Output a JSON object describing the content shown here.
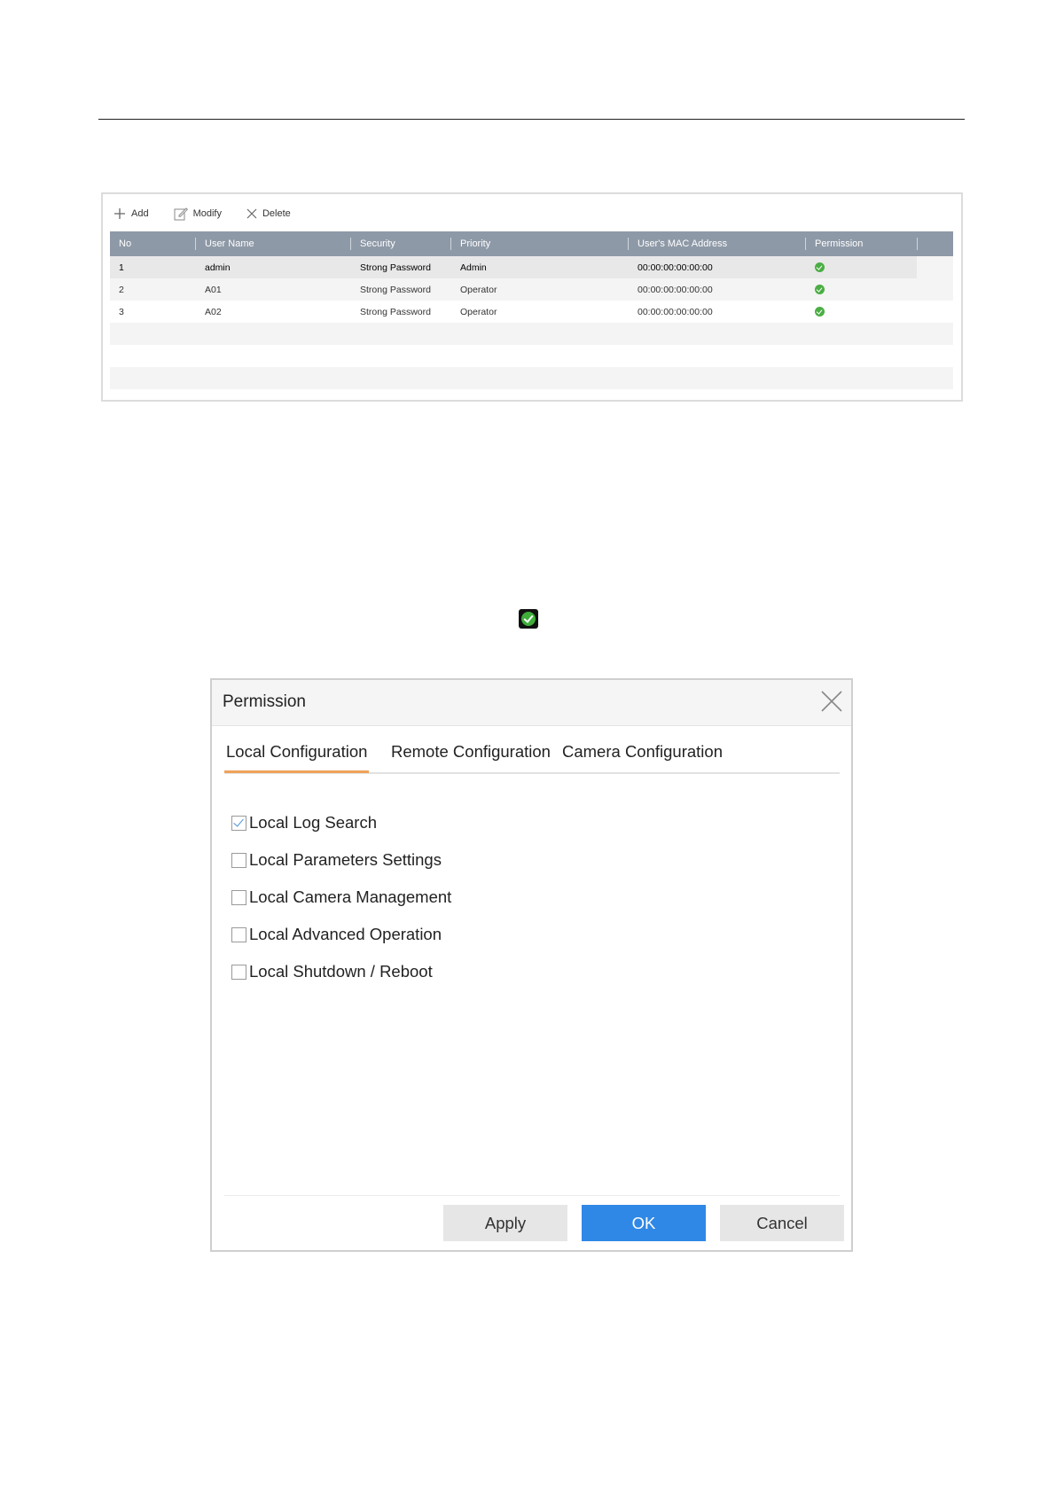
{
  "toolbar": {
    "add": "Add",
    "modify": "Modify",
    "delete": "Delete"
  },
  "user_table": {
    "columns": [
      "No",
      "User Name",
      "Security",
      "Priority",
      "User's MAC Address",
      "Permission"
    ],
    "rows": [
      {
        "no": "1",
        "user_name": "admin",
        "security": "Strong Password",
        "priority": "Admin",
        "mac": "00:00:00:00:00:00",
        "permission": "check"
      },
      {
        "no": "2",
        "user_name": "A01",
        "security": "Strong Password",
        "priority": "Operator",
        "mac": "00:00:00:00:00:00",
        "permission": "check"
      },
      {
        "no": "3",
        "user_name": "A02",
        "security": "Strong Password",
        "priority": "Operator",
        "mac": "00:00:00:00:00:00",
        "permission": "check"
      }
    ]
  },
  "dialog": {
    "title": "Permission",
    "tabs": [
      "Local Configuration",
      "Remote Configuration",
      "Camera Configuration"
    ],
    "active_tab": "Local Configuration",
    "options": [
      {
        "label": "Local Log Search",
        "checked": true
      },
      {
        "label": "Local Parameters Settings",
        "checked": false
      },
      {
        "label": "Local Camera Management",
        "checked": false
      },
      {
        "label": "Local Advanced Operation",
        "checked": false
      },
      {
        "label": "Local Shutdown / Reboot",
        "checked": false
      }
    ],
    "buttons": {
      "apply": "Apply",
      "ok": "OK",
      "cancel": "Cancel"
    }
  },
  "colors": {
    "accent_tab": "#f0a25a",
    "primary_button": "#2f88e6",
    "table_header": "#8e99a7",
    "permission_ok": "#4bae44"
  }
}
